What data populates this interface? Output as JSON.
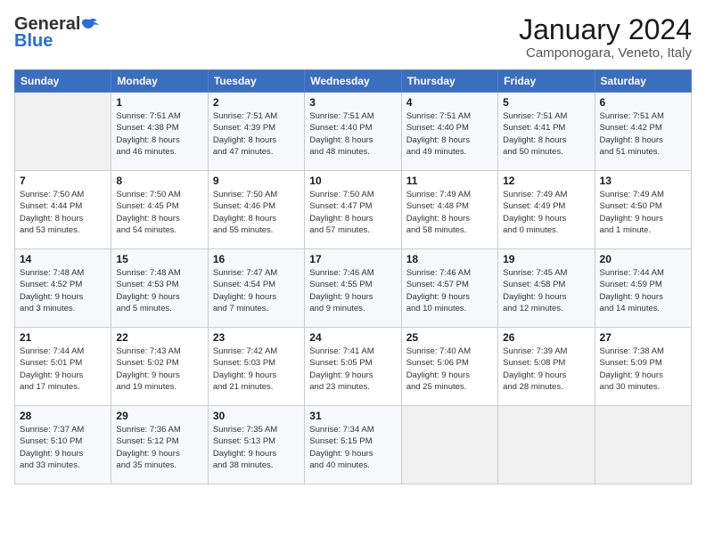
{
  "header": {
    "logo_general": "General",
    "logo_blue": "Blue",
    "month": "January 2024",
    "location": "Camponogara, Veneto, Italy"
  },
  "days_of_week": [
    "Sunday",
    "Monday",
    "Tuesday",
    "Wednesday",
    "Thursday",
    "Friday",
    "Saturday"
  ],
  "weeks": [
    [
      {
        "day": "",
        "info": ""
      },
      {
        "day": "1",
        "info": "Sunrise: 7:51 AM\nSunset: 4:38 PM\nDaylight: 8 hours\nand 46 minutes."
      },
      {
        "day": "2",
        "info": "Sunrise: 7:51 AM\nSunset: 4:39 PM\nDaylight: 8 hours\nand 47 minutes."
      },
      {
        "day": "3",
        "info": "Sunrise: 7:51 AM\nSunset: 4:40 PM\nDaylight: 8 hours\nand 48 minutes."
      },
      {
        "day": "4",
        "info": "Sunrise: 7:51 AM\nSunset: 4:40 PM\nDaylight: 8 hours\nand 49 minutes."
      },
      {
        "day": "5",
        "info": "Sunrise: 7:51 AM\nSunset: 4:41 PM\nDaylight: 8 hours\nand 50 minutes."
      },
      {
        "day": "6",
        "info": "Sunrise: 7:51 AM\nSunset: 4:42 PM\nDaylight: 8 hours\nand 51 minutes."
      }
    ],
    [
      {
        "day": "7",
        "info": "Sunrise: 7:50 AM\nSunset: 4:44 PM\nDaylight: 8 hours\nand 53 minutes."
      },
      {
        "day": "8",
        "info": "Sunrise: 7:50 AM\nSunset: 4:45 PM\nDaylight: 8 hours\nand 54 minutes."
      },
      {
        "day": "9",
        "info": "Sunrise: 7:50 AM\nSunset: 4:46 PM\nDaylight: 8 hours\nand 55 minutes."
      },
      {
        "day": "10",
        "info": "Sunrise: 7:50 AM\nSunset: 4:47 PM\nDaylight: 8 hours\nand 57 minutes."
      },
      {
        "day": "11",
        "info": "Sunrise: 7:49 AM\nSunset: 4:48 PM\nDaylight: 8 hours\nand 58 minutes."
      },
      {
        "day": "12",
        "info": "Sunrise: 7:49 AM\nSunset: 4:49 PM\nDaylight: 9 hours\nand 0 minutes."
      },
      {
        "day": "13",
        "info": "Sunrise: 7:49 AM\nSunset: 4:50 PM\nDaylight: 9 hours\nand 1 minute."
      }
    ],
    [
      {
        "day": "14",
        "info": "Sunrise: 7:48 AM\nSunset: 4:52 PM\nDaylight: 9 hours\nand 3 minutes."
      },
      {
        "day": "15",
        "info": "Sunrise: 7:48 AM\nSunset: 4:53 PM\nDaylight: 9 hours\nand 5 minutes."
      },
      {
        "day": "16",
        "info": "Sunrise: 7:47 AM\nSunset: 4:54 PM\nDaylight: 9 hours\nand 7 minutes."
      },
      {
        "day": "17",
        "info": "Sunrise: 7:46 AM\nSunset: 4:55 PM\nDaylight: 9 hours\nand 9 minutes."
      },
      {
        "day": "18",
        "info": "Sunrise: 7:46 AM\nSunset: 4:57 PM\nDaylight: 9 hours\nand 10 minutes."
      },
      {
        "day": "19",
        "info": "Sunrise: 7:45 AM\nSunset: 4:58 PM\nDaylight: 9 hours\nand 12 minutes."
      },
      {
        "day": "20",
        "info": "Sunrise: 7:44 AM\nSunset: 4:59 PM\nDaylight: 9 hours\nand 14 minutes."
      }
    ],
    [
      {
        "day": "21",
        "info": "Sunrise: 7:44 AM\nSunset: 5:01 PM\nDaylight: 9 hours\nand 17 minutes."
      },
      {
        "day": "22",
        "info": "Sunrise: 7:43 AM\nSunset: 5:02 PM\nDaylight: 9 hours\nand 19 minutes."
      },
      {
        "day": "23",
        "info": "Sunrise: 7:42 AM\nSunset: 5:03 PM\nDaylight: 9 hours\nand 21 minutes."
      },
      {
        "day": "24",
        "info": "Sunrise: 7:41 AM\nSunset: 5:05 PM\nDaylight: 9 hours\nand 23 minutes."
      },
      {
        "day": "25",
        "info": "Sunrise: 7:40 AM\nSunset: 5:06 PM\nDaylight: 9 hours\nand 25 minutes."
      },
      {
        "day": "26",
        "info": "Sunrise: 7:39 AM\nSunset: 5:08 PM\nDaylight: 9 hours\nand 28 minutes."
      },
      {
        "day": "27",
        "info": "Sunrise: 7:38 AM\nSunset: 5:09 PM\nDaylight: 9 hours\nand 30 minutes."
      }
    ],
    [
      {
        "day": "28",
        "info": "Sunrise: 7:37 AM\nSunset: 5:10 PM\nDaylight: 9 hours\nand 33 minutes."
      },
      {
        "day": "29",
        "info": "Sunrise: 7:36 AM\nSunset: 5:12 PM\nDaylight: 9 hours\nand 35 minutes."
      },
      {
        "day": "30",
        "info": "Sunrise: 7:35 AM\nSunset: 5:13 PM\nDaylight: 9 hours\nand 38 minutes."
      },
      {
        "day": "31",
        "info": "Sunrise: 7:34 AM\nSunset: 5:15 PM\nDaylight: 9 hours\nand 40 minutes."
      },
      {
        "day": "",
        "info": ""
      },
      {
        "day": "",
        "info": ""
      },
      {
        "day": "",
        "info": ""
      }
    ]
  ]
}
